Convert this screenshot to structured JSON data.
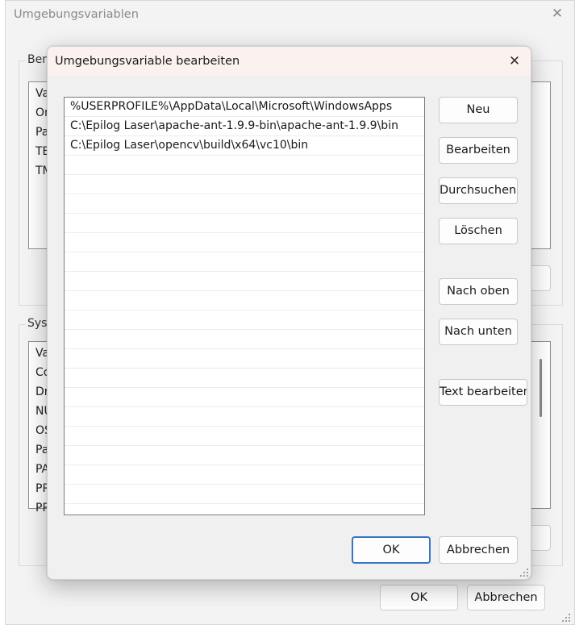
{
  "background_window": {
    "title": "Umgebungsvariablen",
    "user_group_label": "Benu",
    "user_rows": [
      "Va",
      "Or",
      "Pa",
      "TE",
      "TM"
    ],
    "system_group_label": "Syste",
    "system_rows": [
      "Va",
      "Co",
      "Dr",
      "NU",
      "OS",
      "Pa",
      "PA",
      "PR",
      "PR"
    ],
    "ok_label": "OK",
    "cancel_label": "Abbrechen"
  },
  "dialog": {
    "title": "Umgebungsvariable bearbeiten",
    "paths": [
      "%USERPROFILE%\\AppData\\Local\\Microsoft\\WindowsApps",
      "C:\\Epilog Laser\\apache-ant-1.9.9-bin\\apache-ant-1.9.9\\bin",
      "C:\\Epilog Laser\\opencv\\build\\x64\\vc10\\bin"
    ],
    "buttons": {
      "new": "Neu",
      "edit": "Bearbeiten",
      "browse": "Durchsuchen...",
      "delete": "Löschen",
      "move_up": "Nach oben",
      "move_down": "Nach unten",
      "edit_text": "Text bearbeiten...",
      "ok": "OK",
      "cancel": "Abbrechen"
    }
  },
  "colors": {
    "window_bg": "#f3f3f3",
    "dialog_titlebar": "#fbf2ef",
    "accent": "#3a74c4"
  },
  "icons": {
    "close": "close-icon",
    "resize": "resize-grip-icon"
  }
}
